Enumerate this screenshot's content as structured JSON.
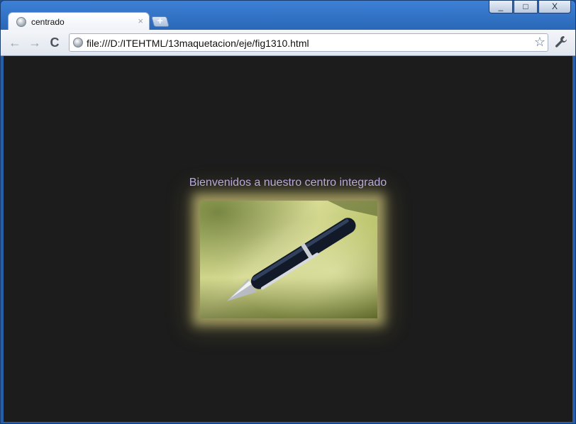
{
  "window": {
    "caption_buttons": {
      "minimize": "_",
      "maximize": "□",
      "close": "X"
    }
  },
  "tabs": [
    {
      "title": "centrado",
      "close": "×",
      "favicon": "globe-icon"
    }
  ],
  "new_tab": {
    "label": "+"
  },
  "toolbar": {
    "back": "←",
    "forward": "→",
    "reload": "C",
    "url": "file:///D:/ITEHTML/13maquetacion/eje/fig1310.html",
    "star": "☆",
    "menu_icon": "wrench-icon"
  },
  "page": {
    "heading": "Bienvenidos a nuestro centro integrado",
    "background": "#1c1c1c",
    "heading_color": "#b9a8e6",
    "image_glow_color": "#ece28c"
  }
}
